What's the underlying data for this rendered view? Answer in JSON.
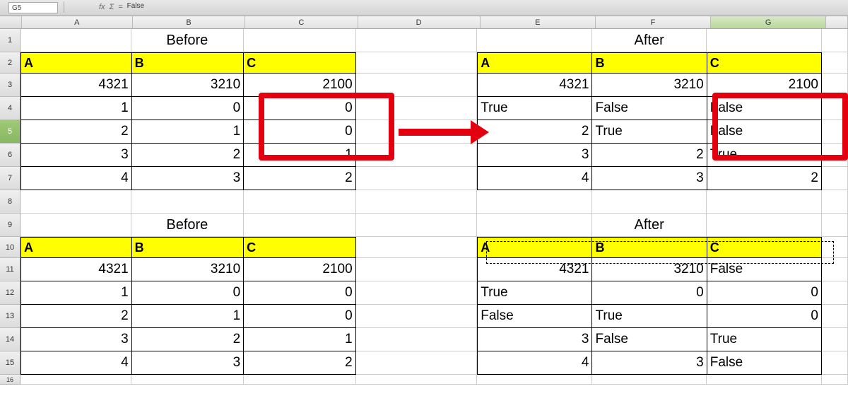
{
  "toolbar": {
    "cellref": "G5",
    "formula_value": "False",
    "fx": "fx",
    "sigma": "Σ",
    "eq": "="
  },
  "cols": [
    "A",
    "B",
    "C",
    "D",
    "E",
    "F",
    "G"
  ],
  "rows": [
    "1",
    "2",
    "3",
    "4",
    "5",
    "6",
    "7",
    "8",
    "9",
    "10",
    "11",
    "12",
    "13",
    "14",
    "15",
    "16"
  ],
  "titles": {
    "before": "Before",
    "after": "After"
  },
  "headers": {
    "a": "A",
    "b": "B",
    "c": "C"
  },
  "block1_before": {
    "r3": {
      "a": "4321",
      "b": "3210",
      "c": "2100"
    },
    "r4": {
      "a": "1",
      "b": "0",
      "c": "0"
    },
    "r5": {
      "a": "2",
      "b": "1",
      "c": "0"
    },
    "r6": {
      "a": "3",
      "b": "2",
      "c": "1"
    },
    "r7": {
      "a": "4",
      "b": "3",
      "c": "2"
    }
  },
  "block1_after": {
    "r3": {
      "e": "4321",
      "f": "3210",
      "g": "2100"
    },
    "r4": {
      "e": "True",
      "f": "False",
      "g": "False"
    },
    "r5": {
      "e": "2",
      "f": "True",
      "g": "False"
    },
    "r6": {
      "e": "3",
      "f": "2",
      "g": "True"
    },
    "r7": {
      "e": "4",
      "f": "3",
      "g": "2"
    }
  },
  "block2_before": {
    "r11": {
      "a": "4321",
      "b": "3210",
      "c": "2100"
    },
    "r12": {
      "a": "1",
      "b": "0",
      "c": "0"
    },
    "r13": {
      "a": "2",
      "b": "1",
      "c": "0"
    },
    "r14": {
      "a": "3",
      "b": "2",
      "c": "1"
    },
    "r15": {
      "a": "4",
      "b": "3",
      "c": "2"
    }
  },
  "block2_after": {
    "r11": {
      "e": "4321",
      "f": "3210",
      "g": "False"
    },
    "r12": {
      "e": "True",
      "f": "0",
      "g": "0"
    },
    "r13": {
      "e": "False",
      "f": "True",
      "g": "0"
    },
    "r14": {
      "e": "3",
      "f": "False",
      "g": "True"
    },
    "r15": {
      "e": "4",
      "f": "3",
      "g": "False"
    }
  }
}
